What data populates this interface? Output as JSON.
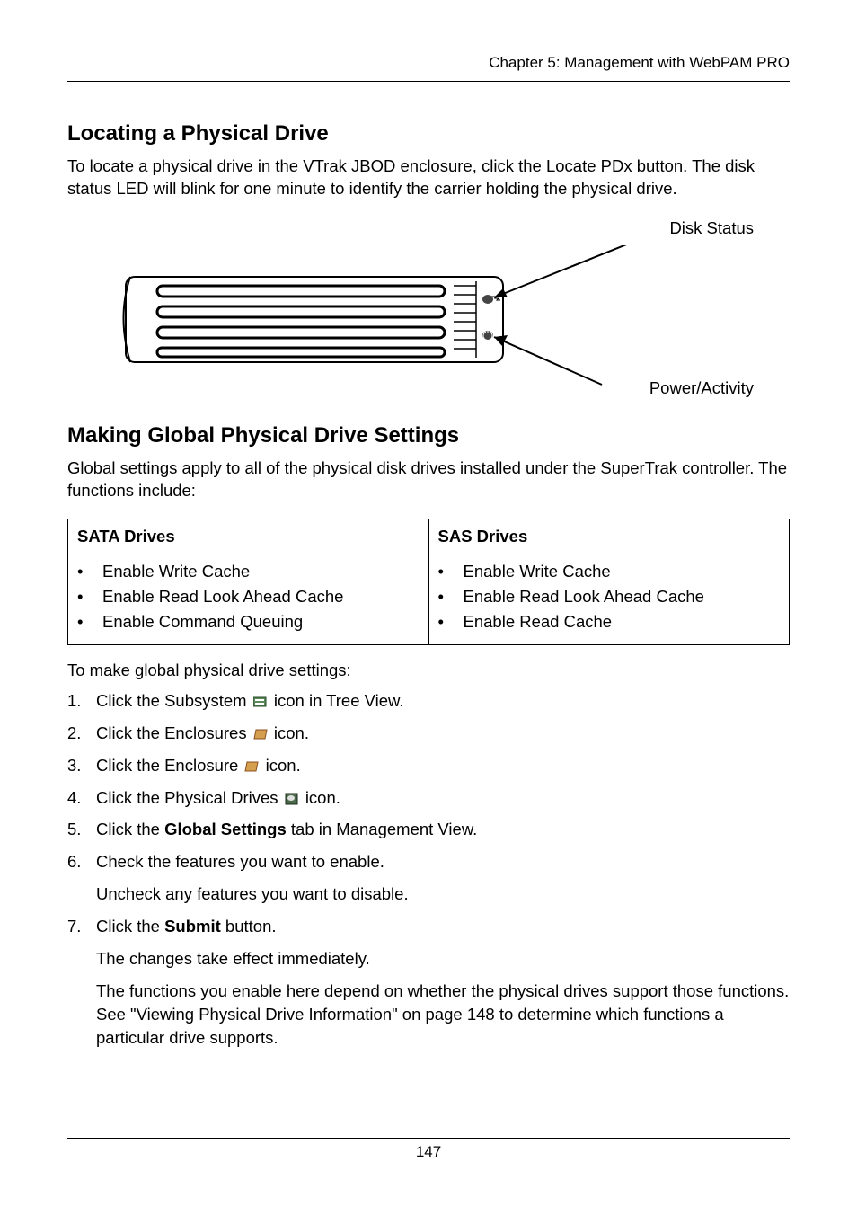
{
  "header": {
    "chapter": "Chapter 5: Management with WebPAM PRO"
  },
  "section1": {
    "title": "Locating a Physical Drive",
    "body": "To locate a physical drive in the VTrak JBOD enclosure, click the Locate PDx button. The disk status LED will blink for one minute to identify the carrier holding the physical drive."
  },
  "figure": {
    "disk_status_label": "Disk Status",
    "power_activity_label": "Power/Activity"
  },
  "section2": {
    "title": "Making Global Physical Drive Settings",
    "intro": "Global settings apply to all of the physical disk drives installed under the SuperTrak controller. The functions include:",
    "table": {
      "headers": [
        "SATA Drives",
        "SAS Drives"
      ],
      "sata": [
        "Enable Write Cache",
        "Enable Read Look Ahead Cache",
        "Enable Command Queuing"
      ],
      "sas": [
        "Enable Write Cache",
        "Enable Read Look Ahead Cache",
        "Enable Read Cache"
      ]
    },
    "lead": "To make global physical drive settings:",
    "steps": [
      {
        "num": "1.",
        "pre": "Click the Subsystem ",
        "post": " icon in Tree View.",
        "icon": "subsystem-icon"
      },
      {
        "num": "2.",
        "pre": "Click the Enclosures ",
        "post": " icon.",
        "icon": "enclosures-icon"
      },
      {
        "num": "3.",
        "pre": "Click the Enclosure ",
        "post": " icon.",
        "icon": "enclosure-icon"
      },
      {
        "num": "4.",
        "pre": "Click the Physical Drives ",
        "post": " icon.",
        "icon": "physical-drives-icon"
      },
      {
        "num": "5.",
        "pre": "Click the ",
        "bold": "Global Settings",
        "post": " tab in Management View."
      },
      {
        "num": "6.",
        "text": "Check the features you want to enable.",
        "sub": "Uncheck any features you want to disable."
      },
      {
        "num": "7.",
        "pre": "Click the ",
        "bold": "Submit",
        "post": " button.",
        "sub": "The changes take effect immediately.",
        "sub2": "The functions you enable here depend on whether the physical drives support those functions. See \"Viewing Physical Drive Information\" on page 148 to determine which functions a particular drive supports."
      }
    ]
  },
  "page_number": "147"
}
